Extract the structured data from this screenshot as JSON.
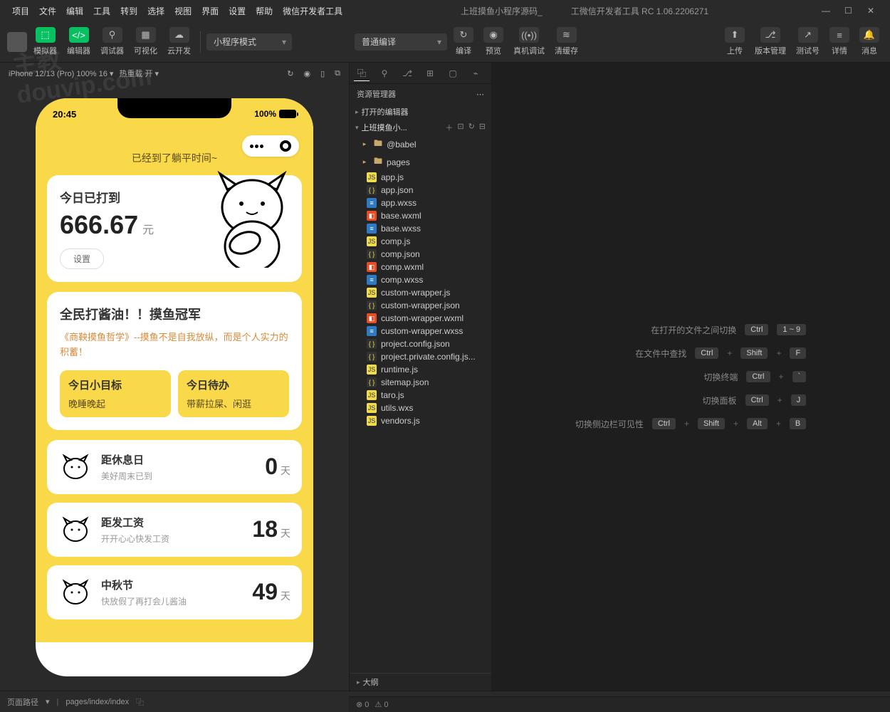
{
  "titlebar": {
    "menus": [
      "项目",
      "文件",
      "编辑",
      "工具",
      "转到",
      "选择",
      "视图",
      "界面",
      "设置",
      "帮助",
      "微信开发者工具"
    ],
    "projectName": "上班摸鱼小程序源码_",
    "appTitle": "工微信开发者工具 RC 1.06.2206271"
  },
  "toolbar": {
    "main": [
      {
        "label": "模拟器",
        "green": true
      },
      {
        "label": "编辑器",
        "green": true
      },
      {
        "label": "调试器",
        "green": false
      },
      {
        "label": "可视化",
        "green": false
      },
      {
        "label": "云开发",
        "green": false
      }
    ],
    "modeSelect": "小程序模式",
    "compileSelect": "普通编译",
    "mid": [
      {
        "label": "编译"
      },
      {
        "label": "预览"
      },
      {
        "label": "真机调试"
      },
      {
        "label": "清缓存"
      }
    ],
    "right": [
      {
        "label": "上传"
      },
      {
        "label": "版本管理"
      },
      {
        "label": "测试号"
      },
      {
        "label": "详情"
      },
      {
        "label": "消息"
      }
    ]
  },
  "simHeader": {
    "device": "iPhone 12/13 (Pro) 100% 16 ▾",
    "hotReload": "热重载 开 ▾"
  },
  "phone": {
    "time": "20:45",
    "battery": "100%",
    "greeting": "已经到了躺平时间~",
    "checkin": {
      "title": "今日已打到",
      "amount": "666.67",
      "unit": "元",
      "settings": "设置"
    },
    "champion": {
      "title": "全民打酱油！！摸鱼冠军",
      "sub": "《商鞅摸鱼哲学》--摸鱼不是自我放纵，而是个人实力的积蓄！"
    },
    "goals": [
      {
        "t": "今日小目标",
        "d": "晚睡晚起"
      },
      {
        "t": "今日待办",
        "d": "带薪拉屎、闲逛"
      }
    ],
    "counts": [
      {
        "title": "距休息日",
        "sub": "美好周末已到",
        "num": "0",
        "unit": "天"
      },
      {
        "title": "距发工资",
        "sub": "开开心心快发工资",
        "num": "18",
        "unit": "天"
      },
      {
        "title": "中秋节",
        "sub": "快放假了再打会儿酱油",
        "num": "49",
        "unit": "天"
      }
    ]
  },
  "explorer": {
    "title": "资源管理器",
    "openEditors": "打开的编辑器",
    "projectName": "上班摸鱼小...",
    "files": [
      {
        "name": "@babel",
        "type": "folder"
      },
      {
        "name": "pages",
        "type": "folder",
        "icon": "pages"
      },
      {
        "name": "app.js",
        "type": "js"
      },
      {
        "name": "app.json",
        "type": "json"
      },
      {
        "name": "app.wxss",
        "type": "wxss"
      },
      {
        "name": "base.wxml",
        "type": "wxml"
      },
      {
        "name": "base.wxss",
        "type": "wxss"
      },
      {
        "name": "comp.js",
        "type": "js"
      },
      {
        "name": "comp.json",
        "type": "json"
      },
      {
        "name": "comp.wxml",
        "type": "wxml"
      },
      {
        "name": "comp.wxss",
        "type": "wxss"
      },
      {
        "name": "custom-wrapper.js",
        "type": "js"
      },
      {
        "name": "custom-wrapper.json",
        "type": "json"
      },
      {
        "name": "custom-wrapper.wxml",
        "type": "wxml"
      },
      {
        "name": "custom-wrapper.wxss",
        "type": "wxss"
      },
      {
        "name": "project.config.json",
        "type": "json"
      },
      {
        "name": "project.private.config.js...",
        "type": "json"
      },
      {
        "name": "runtime.js",
        "type": "js"
      },
      {
        "name": "sitemap.json",
        "type": "json"
      },
      {
        "name": "taro.js",
        "type": "js"
      },
      {
        "name": "utils.wxs",
        "type": "wxs"
      },
      {
        "name": "vendors.js",
        "type": "js"
      }
    ],
    "outline": "大纲"
  },
  "hints": [
    {
      "label": "在打开的文件之间切换",
      "keys": [
        "Ctrl",
        "1 ~ 9"
      ]
    },
    {
      "label": "在文件中查找",
      "keys": [
        "Ctrl",
        "+",
        "Shift",
        "+",
        "F"
      ]
    },
    {
      "label": "切换终端",
      "keys": [
        "Ctrl",
        "+",
        "`"
      ]
    },
    {
      "label": "切换面板",
      "keys": [
        "Ctrl",
        "+",
        "J"
      ]
    },
    {
      "label": "切换侧边栏可见性",
      "keys": [
        "Ctrl",
        "+",
        "Shift",
        "+",
        "Alt",
        "+",
        "B"
      ]
    }
  ],
  "bottombar": {
    "pathLabel": "页面路径",
    "path": "pages/index/index"
  },
  "statusFooter": {
    "errors": "0",
    "warnings": "0"
  },
  "watermark": {
    "l1": "主教",
    "l2": "douvip.com"
  }
}
